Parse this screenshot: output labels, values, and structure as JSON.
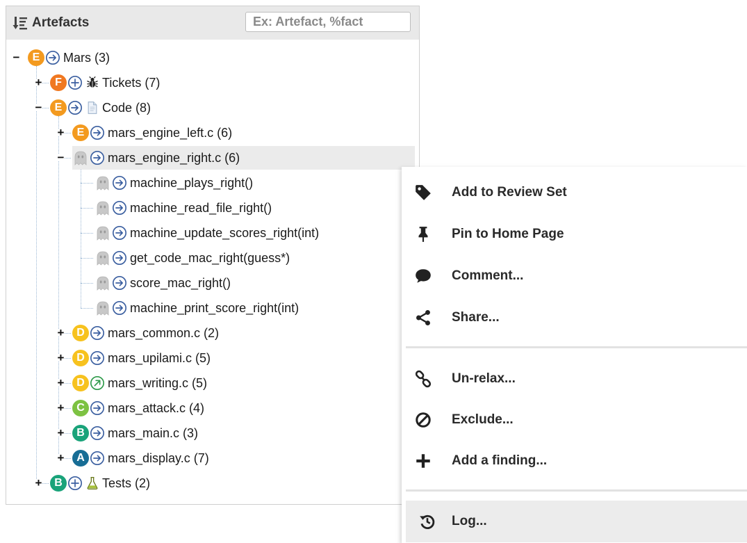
{
  "panel": {
    "title": "Artefacts",
    "search_placeholder": "Ex: Artefact, %fact"
  },
  "tree": [
    {
      "level": 0,
      "toggle": "−",
      "grade": "E",
      "grade_color": "#f39a1f",
      "nav": "circle-arrow-right-icon",
      "type_icon": "",
      "label": "Mars (3)"
    },
    {
      "level": 1,
      "toggle": "+",
      "grade": "F",
      "grade_color": "#f07821",
      "nav": "circle-plus-icon",
      "type_icon": "bug-icon",
      "label": "Tickets (7)"
    },
    {
      "level": 1,
      "toggle": "−",
      "grade": "E",
      "grade_color": "#f39a1f",
      "nav": "circle-arrow-right-icon",
      "type_icon": "file-icon",
      "label": "Code (8)"
    },
    {
      "level": 2,
      "toggle": "+",
      "grade": "E",
      "grade_color": "#f39a1f",
      "nav": "circle-arrow-right-icon",
      "type_icon": "",
      "label": "mars_engine_left.c (6)"
    },
    {
      "level": 2,
      "toggle": "−",
      "grade": "",
      "grade_color": "",
      "nav": "circle-arrow-right-icon",
      "type_icon": "",
      "label": "mars_engine_right.c (6)",
      "selected": true
    },
    {
      "level": 3,
      "toggle": "",
      "grade": "",
      "grade_color": "",
      "nav": "circle-arrow-right-icon",
      "type_icon": "",
      "label": "machine_plays_right()"
    },
    {
      "level": 3,
      "toggle": "",
      "grade": "",
      "grade_color": "",
      "nav": "circle-arrow-right-icon",
      "type_icon": "",
      "label": "machine_read_file_right()"
    },
    {
      "level": 3,
      "toggle": "",
      "grade": "",
      "grade_color": "",
      "nav": "circle-arrow-right-icon",
      "type_icon": "",
      "label": "machine_update_scores_right(int)"
    },
    {
      "level": 3,
      "toggle": "",
      "grade": "",
      "grade_color": "",
      "nav": "circle-arrow-right-icon",
      "type_icon": "",
      "label": "get_code_mac_right(guess*)"
    },
    {
      "level": 3,
      "toggle": "",
      "grade": "",
      "grade_color": "",
      "nav": "circle-arrow-right-icon",
      "type_icon": "",
      "label": "score_mac_right()"
    },
    {
      "level": 3,
      "toggle": "",
      "grade": "",
      "grade_color": "",
      "nav": "circle-arrow-right-icon",
      "type_icon": "",
      "label": "machine_print_score_right(int)"
    },
    {
      "level": 2,
      "toggle": "+",
      "grade": "D",
      "grade_color": "#f7c21e",
      "nav": "circle-arrow-right-icon",
      "type_icon": "",
      "label": "mars_common.c (2)"
    },
    {
      "level": 2,
      "toggle": "+",
      "grade": "D",
      "grade_color": "#f7c21e",
      "nav": "circle-arrow-right-icon",
      "type_icon": "",
      "label": "mars_upilami.c (5)"
    },
    {
      "level": 2,
      "toggle": "+",
      "grade": "D",
      "grade_color": "#f7c21e",
      "nav": "circle-arrow-up-right-icon",
      "type_icon": "",
      "label": "mars_writing.c (5)"
    },
    {
      "level": 2,
      "toggle": "+",
      "grade": "C",
      "grade_color": "#7dc242",
      "nav": "circle-arrow-right-icon",
      "type_icon": "",
      "label": "mars_attack.c (4)"
    },
    {
      "level": 2,
      "toggle": "+",
      "grade": "B",
      "grade_color": "#1aa37a",
      "nav": "circle-arrow-right-icon",
      "type_icon": "",
      "label": "mars_main.c (3)"
    },
    {
      "level": 2,
      "toggle": "+",
      "grade": "A",
      "grade_color": "#176d95",
      "nav": "circle-arrow-right-icon",
      "type_icon": "",
      "label": "mars_display.c (7)"
    },
    {
      "level": 1,
      "toggle": "+",
      "grade": "B",
      "grade_color": "#1aa37a",
      "nav": "circle-plus-icon",
      "type_icon": "flask-icon",
      "label": "Tests (2)"
    }
  ],
  "menu": {
    "items": [
      {
        "icon": "tag-icon",
        "label": "Add to Review Set"
      },
      {
        "icon": "pin-icon",
        "label": "Pin to Home Page"
      },
      {
        "icon": "comment-icon",
        "label": "Comment..."
      },
      {
        "icon": "share-icon",
        "label": "Share..."
      },
      {
        "icon": "link-icon",
        "label": "Un-relax..."
      },
      {
        "icon": "ban-icon",
        "label": "Exclude..."
      },
      {
        "icon": "plus-icon",
        "label": "Add a finding..."
      },
      {
        "icon": "history-icon",
        "label": "Log..."
      }
    ]
  },
  "colors": {
    "nav_icon": "#3b5fa0",
    "ghost": "#c8c8c8",
    "selected_row": "#ebebeb",
    "menu_hover": "#ececec"
  }
}
